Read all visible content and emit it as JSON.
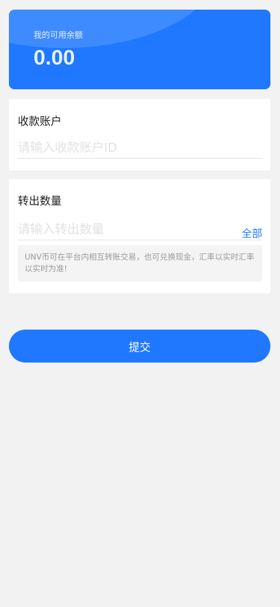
{
  "balance": {
    "label": "我的可用余额",
    "value": "0.00"
  },
  "account": {
    "title": "收款账户",
    "placeholder": "请输入收款账户ID"
  },
  "amount": {
    "title": "转出数量",
    "placeholder": "请输入转出数量",
    "all_label": "全部",
    "notice": "UNV币可在平台内相互转账交易，也可兑换现金，汇率以实时汇率以实时为准!"
  },
  "submit_label": "提交",
  "colors": {
    "primary": "#1f78ff",
    "background": "#f2f2f2",
    "notice_bg": "#f4f4f4"
  }
}
